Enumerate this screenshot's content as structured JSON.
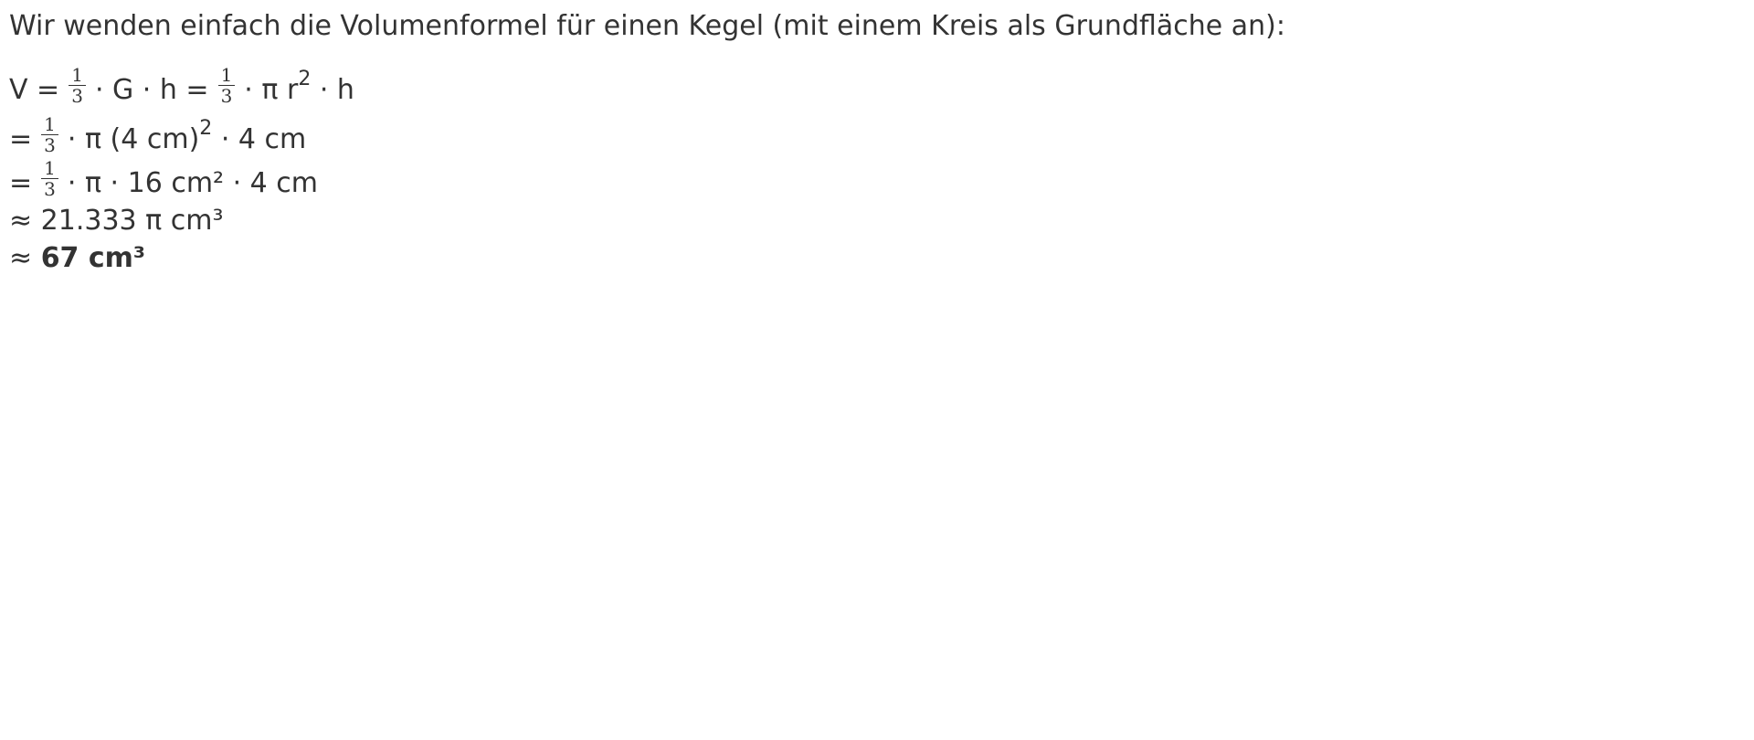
{
  "intro": "Wir wenden einfach die Volumenformel für einen Kegel (mit einem Kreis als Grundfläche an):",
  "line1": {
    "a": "V =",
    "frac1_num": "1",
    "frac1_den": "3",
    "b": "· G · h =",
    "frac2_num": "1",
    "frac2_den": "3",
    "c": "· π r",
    "sup": "2",
    "d": " · h"
  },
  "line2": {
    "a": "=",
    "frac_num": "1",
    "frac_den": "3",
    "b": "· π (4 cm)",
    "sup": "2",
    "c": " · 4 cm"
  },
  "line3": {
    "a": "=",
    "frac_num": "1",
    "frac_den": "3",
    "b": "· π · 16 cm² · 4 cm"
  },
  "line4": {
    "text": "≈ 21.333 π cm³"
  },
  "line5": {
    "prefix": "≈ ",
    "result": "67 cm³"
  }
}
